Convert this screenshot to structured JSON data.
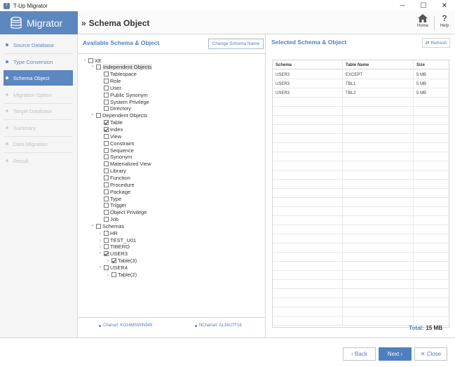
{
  "window": {
    "title": "T-Up Migrator",
    "app_icon_glyph": "T",
    "minimize_glyph": "─",
    "maximize_glyph": "☐",
    "close_glyph": "✕"
  },
  "brand": {
    "name": "Migrator",
    "icon": "database-icon",
    "color": "#5d87bf"
  },
  "header": {
    "title": "Schema Object",
    "chevron": "»",
    "home_label": "Home",
    "help_label": "Help",
    "help_glyph": "?"
  },
  "sidebar": {
    "steps": [
      {
        "label": "Source Database",
        "state": "done"
      },
      {
        "label": "Type Conversion",
        "state": "done"
      },
      {
        "label": "Schema Object",
        "state": "active"
      },
      {
        "label": "Migration Option",
        "state": "pending"
      },
      {
        "label": "Target Database",
        "state": "pending"
      },
      {
        "label": "Summary",
        "state": "pending"
      },
      {
        "label": "Data Migration",
        "state": "pending"
      },
      {
        "label": "Result",
        "state": "pending"
      }
    ]
  },
  "available": {
    "title": "Available Schema & Object",
    "change_schema_label": "Change Schema Name",
    "tree": [
      {
        "label": "XE",
        "level": 0,
        "toggle": "expanded",
        "checked": false
      },
      {
        "label": "Independent Objects",
        "level": 1,
        "toggle": "expanded",
        "checked": false,
        "highlight": true
      },
      {
        "label": "Tablespace",
        "level": 2,
        "toggle": "none",
        "checked": false
      },
      {
        "label": "Role",
        "level": 2,
        "toggle": "none",
        "checked": false
      },
      {
        "label": "User",
        "level": 2,
        "toggle": "none",
        "checked": false
      },
      {
        "label": "Public Synonym",
        "level": 2,
        "toggle": "none",
        "checked": false
      },
      {
        "label": "System Privilege",
        "level": 2,
        "toggle": "none",
        "checked": false
      },
      {
        "label": "Directory",
        "level": 2,
        "toggle": "none",
        "checked": false
      },
      {
        "label": "Dependent Objects",
        "level": 1,
        "toggle": "expanded",
        "checked": false
      },
      {
        "label": "Table",
        "level": 2,
        "toggle": "none",
        "checked": true
      },
      {
        "label": "Index",
        "level": 2,
        "toggle": "none",
        "checked": true
      },
      {
        "label": "View",
        "level": 2,
        "toggle": "none",
        "checked": false
      },
      {
        "label": "Constraint",
        "level": 2,
        "toggle": "none",
        "checked": false
      },
      {
        "label": "Sequence",
        "level": 2,
        "toggle": "none",
        "checked": false
      },
      {
        "label": "Synonym",
        "level": 2,
        "toggle": "none",
        "checked": false
      },
      {
        "label": "Materialized View",
        "level": 2,
        "toggle": "none",
        "checked": false
      },
      {
        "label": "Library",
        "level": 2,
        "toggle": "none",
        "checked": false
      },
      {
        "label": "Function",
        "level": 2,
        "toggle": "none",
        "checked": false
      },
      {
        "label": "Procedure",
        "level": 2,
        "toggle": "none",
        "checked": false
      },
      {
        "label": "Package",
        "level": 2,
        "toggle": "none",
        "checked": false
      },
      {
        "label": "Type",
        "level": 2,
        "toggle": "none",
        "checked": false
      },
      {
        "label": "Trigger",
        "level": 2,
        "toggle": "none",
        "checked": false
      },
      {
        "label": "Object Privilege",
        "level": 2,
        "toggle": "none",
        "checked": false
      },
      {
        "label": "Job",
        "level": 2,
        "toggle": "none",
        "checked": false
      },
      {
        "label": "Schemas",
        "level": 1,
        "toggle": "expanded",
        "checked": false
      },
      {
        "label": "HR",
        "level": 2,
        "toggle": "collapsed",
        "checked": false
      },
      {
        "label": "TEST_U01",
        "level": 2,
        "toggle": "collapsed",
        "checked": false
      },
      {
        "label": "TIBERO",
        "level": 2,
        "toggle": "collapsed",
        "checked": false
      },
      {
        "label": "USER3",
        "level": 2,
        "toggle": "expanded",
        "checked": true
      },
      {
        "label": "Table(3)",
        "level": 3,
        "toggle": "collapsed",
        "checked": true
      },
      {
        "label": "USER4",
        "level": 2,
        "toggle": "expanded",
        "checked": false
      },
      {
        "label": "Table(2)",
        "level": 3,
        "toggle": "collapsed",
        "checked": false
      }
    ],
    "charset": "Charset: KO16MSWIN949",
    "ncharset": "NCharset: AL16UTF16"
  },
  "selected": {
    "title": "Selected Schema & Object",
    "refresh_label": "Refresh",
    "refresh_glyph": "⇄",
    "columns": [
      "Schema",
      "Table Name",
      "Size"
    ],
    "rows": [
      [
        "USER3",
        "EXCEPT",
        "5 MB"
      ],
      [
        "USER3",
        "TBL1",
        "5 MB"
      ],
      [
        "USER3",
        "TBL2",
        "5 MB"
      ]
    ],
    "total_label": "Total:",
    "total_value": "15 MB"
  },
  "footer": {
    "back_label": "‹ Back",
    "next_label": "Next ›",
    "close_label": "✕ Close"
  }
}
